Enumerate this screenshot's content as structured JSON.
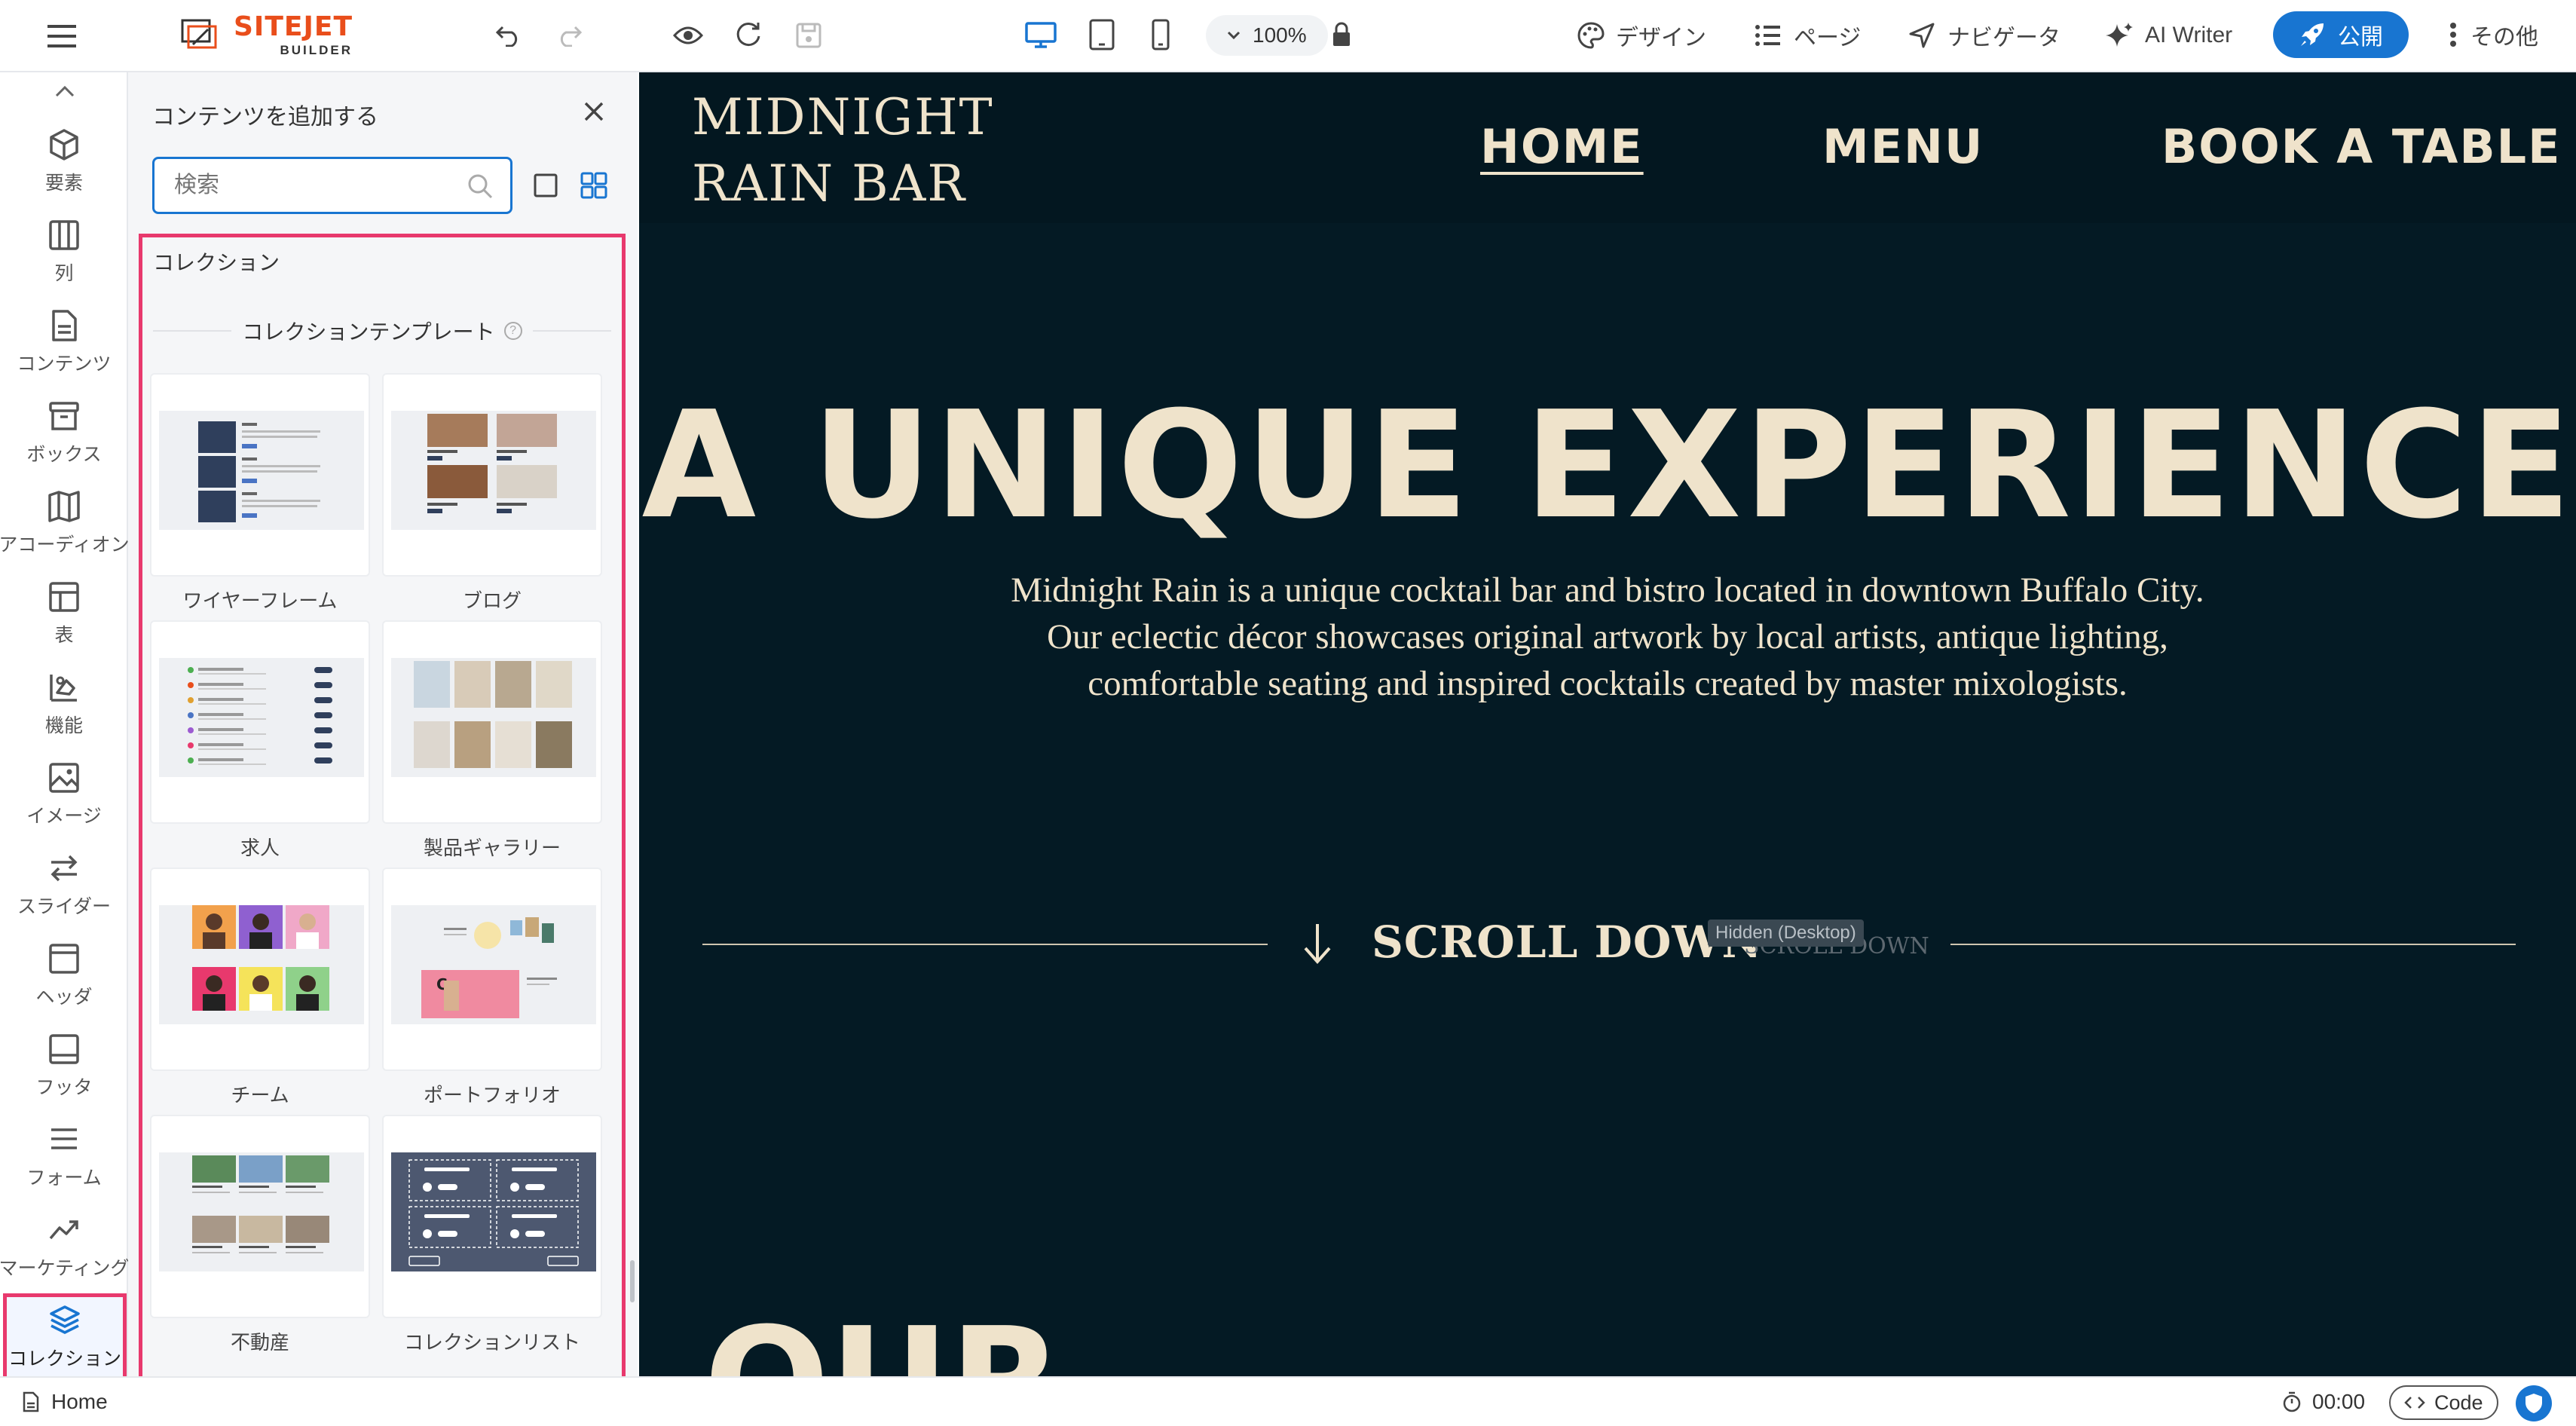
{
  "app": {
    "logo": {
      "main": "SITEJET",
      "sub": "BUILDER"
    },
    "zoom": "100%",
    "nav": {
      "design": "デザイン",
      "page": "ページ",
      "navigator": "ナビゲータ",
      "ai_writer": "AI Writer",
      "publish": "公開",
      "more": "その他"
    },
    "colors": {
      "accent": "#1875d1",
      "highlight": "#e8396d",
      "brand": "#e94e1b"
    }
  },
  "sidebar": {
    "items": [
      {
        "label": "要素",
        "icon": "cube-icon"
      },
      {
        "label": "列",
        "icon": "columns-icon"
      },
      {
        "label": "コンテンツ",
        "icon": "document-icon"
      },
      {
        "label": "ボックス",
        "icon": "box-icon"
      },
      {
        "label": "アコーディオン",
        "icon": "accordion-icon"
      },
      {
        "label": "表",
        "icon": "table-icon"
      },
      {
        "label": "機能",
        "icon": "features-icon"
      },
      {
        "label": "イメージ",
        "icon": "image-icon"
      },
      {
        "label": "スライダー",
        "icon": "slider-icon"
      },
      {
        "label": "ヘッダ",
        "icon": "header-icon"
      },
      {
        "label": "フッタ",
        "icon": "footer-icon"
      },
      {
        "label": "フォーム",
        "icon": "form-icon"
      },
      {
        "label": "マーケティング",
        "icon": "marketing-icon"
      },
      {
        "label": "コレクション",
        "icon": "layers-icon"
      }
    ]
  },
  "panel": {
    "title": "コンテンツを追加する",
    "search_placeholder": "検索",
    "section_title": "コレクション",
    "subsection_title": "コレクションテンプレート",
    "tiles": [
      {
        "label": "ワイヤーフレーム"
      },
      {
        "label": "ブログ"
      },
      {
        "label": "求人"
      },
      {
        "label": "製品ギャラリー"
      },
      {
        "label": "チーム"
      },
      {
        "label": "ポートフォリオ"
      },
      {
        "label": "不動産"
      },
      {
        "label": "コレクションリスト"
      }
    ]
  },
  "site": {
    "logo_line1": "MIDNIGHT",
    "logo_line2": "RAIN BAR",
    "nav": {
      "home": "HOME",
      "menu": "MENU",
      "book": "BOOK A TABLE"
    },
    "hero_title": "A UNIQUE EXPERIENCE",
    "hero_lines": [
      "Midnight Rain is a unique cocktail bar and bistro located in downtown Buffalo City.",
      "Our eclectic décor showcases original artwork by local artists, antique lighting,",
      "comfortable seating and inspired cocktails created by master mixologists."
    ],
    "scroll_down": "SCROLL DOWN",
    "hidden_badge": "Hidden (Desktop)",
    "ghost_scroll": "SCROLL DOWN",
    "next_heading": "OUR"
  },
  "statusbar": {
    "page": "Home",
    "timer": "00:00",
    "code": "Code"
  }
}
